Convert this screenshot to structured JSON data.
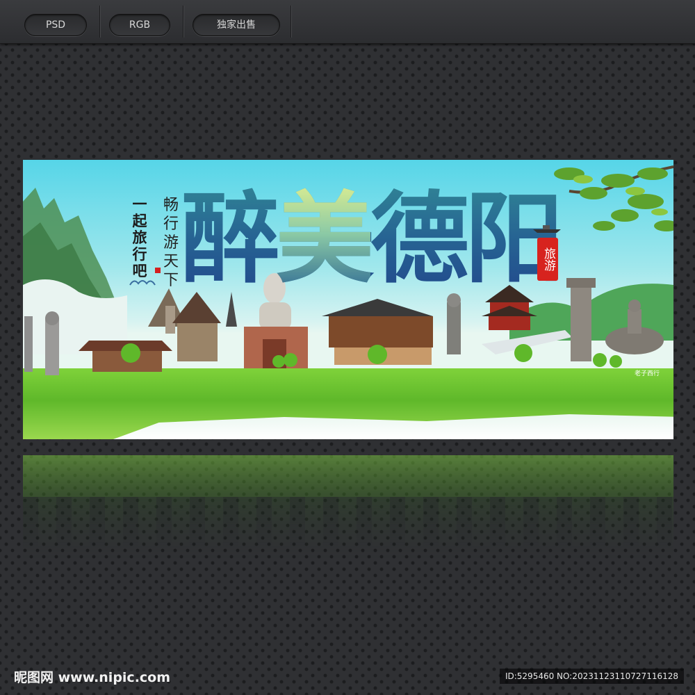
{
  "toolbar": {
    "tags": [
      "PSD",
      "RGB",
      "独家出售"
    ]
  },
  "poster": {
    "title_chars": [
      "醉",
      "美",
      "德",
      "阳"
    ],
    "slogan_left": "一起旅行吧",
    "slogan_mid": "畅行游天下",
    "seal_text": "旅游",
    "sign_small": "老子西行"
  },
  "footer": {
    "logo": "昵图网 www.nipic.com",
    "id_text": "ID:5295460 NO:20231123110727116128"
  },
  "colors": {
    "sky_top": "#56d5e8",
    "grass": "#7fd23a",
    "title_blue": "#1f5b8c",
    "seal_red": "#d7231e"
  }
}
